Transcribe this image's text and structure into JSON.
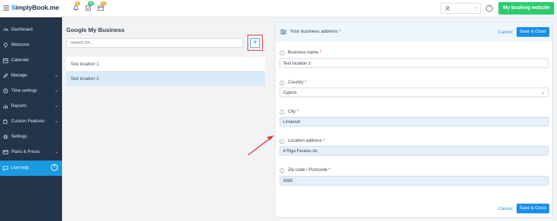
{
  "topbar": {
    "logo_prefix": "S",
    "logo_rest": "implyBook.me",
    "notifications_badge": "1",
    "bookings_badge": "29",
    "calendar_badge": "27",
    "booking_website_label": "My booking website"
  },
  "sidebar": {
    "items": [
      {
        "label": "Dashboard",
        "icon": "dashboard-icon",
        "chevron": false
      },
      {
        "label": "Welcome",
        "icon": "bulb-icon",
        "chevron": false
      },
      {
        "label": "Calendar",
        "icon": "calendar-icon",
        "chevron": false
      },
      {
        "label": "Manage",
        "icon": "pencil-icon",
        "chevron": true
      },
      {
        "label": "Time settings",
        "icon": "clock-icon",
        "chevron": true
      },
      {
        "label": "Reports",
        "icon": "bar-chart-icon",
        "chevron": true
      },
      {
        "label": "Custom Features",
        "icon": "puzzle-icon",
        "chevron": true
      },
      {
        "label": "Settings",
        "icon": "gear-icon",
        "chevron": false
      },
      {
        "label": "Plans & Prices",
        "icon": "card-icon",
        "chevron": true
      }
    ],
    "live_help_label": "Live help",
    "live_help_qmark": "?"
  },
  "gmb": {
    "title": "Google My Business",
    "search_placeholder": "Search for...",
    "add_symbol": "+",
    "locations": [
      "Test location 1",
      "Test location 2"
    ]
  },
  "form": {
    "title": "Your business address",
    "required_mark": "*",
    "cancel_label": "Cancel",
    "save_label": "Save & Close",
    "fields": {
      "business_name": {
        "label": "Business name",
        "value": "Test location 3"
      },
      "country": {
        "label": "Country",
        "value": "Cyprus"
      },
      "city": {
        "label": "City",
        "value": "Limassol"
      },
      "location_address": {
        "label": "Location address",
        "value": "4 Riga Feraiou str."
      },
      "zip": {
        "label": "Zip code / Postcode",
        "value": "3095"
      }
    }
  },
  "colors": {
    "sidebar": "#243449",
    "accent": "#1a8fe8",
    "booking_button": "#2ecc71",
    "annotation": "#e03534"
  }
}
